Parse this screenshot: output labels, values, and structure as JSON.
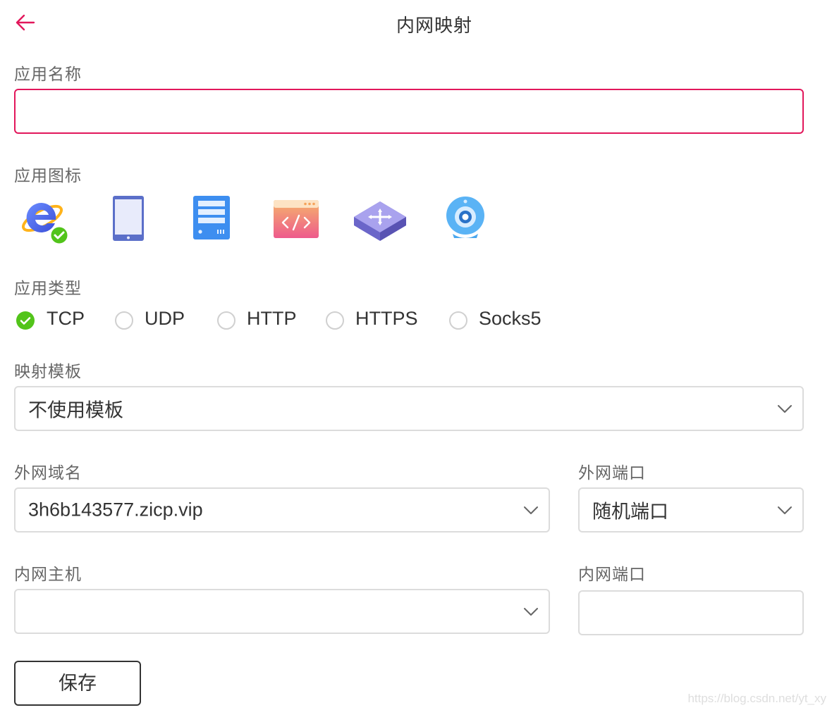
{
  "header": {
    "title": "内网映射",
    "back_icon": "arrow-left-icon",
    "accent_color": "#e2175b"
  },
  "form": {
    "app_name": {
      "label": "应用名称",
      "value": "",
      "placeholder": ""
    },
    "app_icon": {
      "label": "应用图标",
      "options": [
        "ie-browser-icon",
        "tablet-icon",
        "server-icon",
        "code-window-icon",
        "network-switch-icon",
        "webcam-icon"
      ],
      "selected_index": 0
    },
    "app_type": {
      "label": "应用类型",
      "options": [
        "TCP",
        "UDP",
        "HTTP",
        "HTTPS",
        "Socks5"
      ],
      "selected": "TCP"
    },
    "template": {
      "label": "映射模板",
      "value": "不使用模板"
    },
    "external_domain": {
      "label": "外网域名",
      "value": "3h6b143577.zicp.vip"
    },
    "external_port": {
      "label": "外网端口",
      "value": "随机端口"
    },
    "internal_host": {
      "label": "内网主机",
      "value": ""
    },
    "internal_port": {
      "label": "内网端口",
      "value": ""
    },
    "save_label": "保存"
  },
  "watermark": "https://blog.csdn.net/yt_xy",
  "colors": {
    "selected_green": "#52c41a",
    "border": "#dcdcdc",
    "label": "#666666"
  }
}
